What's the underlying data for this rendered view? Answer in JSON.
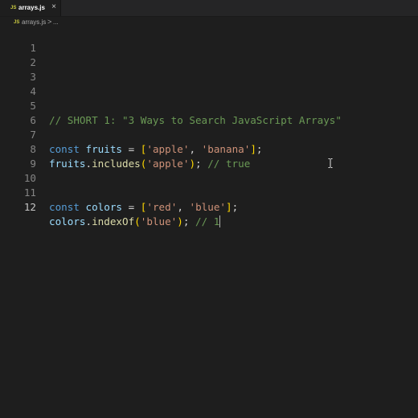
{
  "tab": {
    "icon": "JS",
    "title": "arrays.js",
    "close_icon": "close-icon"
  },
  "breadcrumb": {
    "icon": "JS",
    "file": "arrays.js",
    "separator": ">",
    "ellipsis": "..."
  },
  "editor": {
    "line_numbers": [
      "1",
      "2",
      "3",
      "4",
      "5",
      "6",
      "7",
      "8",
      "9",
      "10",
      "11",
      "12"
    ],
    "active_line": "12",
    "lines": {
      "l5": "// SHORT 1: \"3 Ways to Search JavaScript Arrays\"",
      "l7": {
        "kw": "const",
        "name": "fruits",
        "eq": "=",
        "open": "[",
        "s1": "'apple'",
        "comma": ",",
        "s2": "'banana'",
        "close": "]",
        "semi": ";"
      },
      "l8": {
        "obj": "fruits",
        "dot": ".",
        "fn": "includes",
        "open": "(",
        "arg": "'apple'",
        "close": ")",
        "semi": ";",
        "comment": "// true"
      },
      "l11": {
        "kw": "const",
        "name": "colors",
        "eq": "=",
        "open": "[",
        "s1": "'red'",
        "comma": ",",
        "s2": "'blue'",
        "close": "]",
        "semi": ";"
      },
      "l12": {
        "obj": "colors",
        "dot": ".",
        "fn": "indexOf",
        "open": "(",
        "arg": "'blue'",
        "close": ")",
        "semi": ";",
        "comment": "// 1"
      }
    }
  },
  "colors": {
    "background": "#1e1e1e",
    "comment": "#6a9955",
    "keyword": "#569cd6",
    "variable": "#9cdcfe",
    "string": "#ce9178",
    "function": "#dcdcaa",
    "bracket": "#ffd700",
    "paren": "#da70d6"
  }
}
